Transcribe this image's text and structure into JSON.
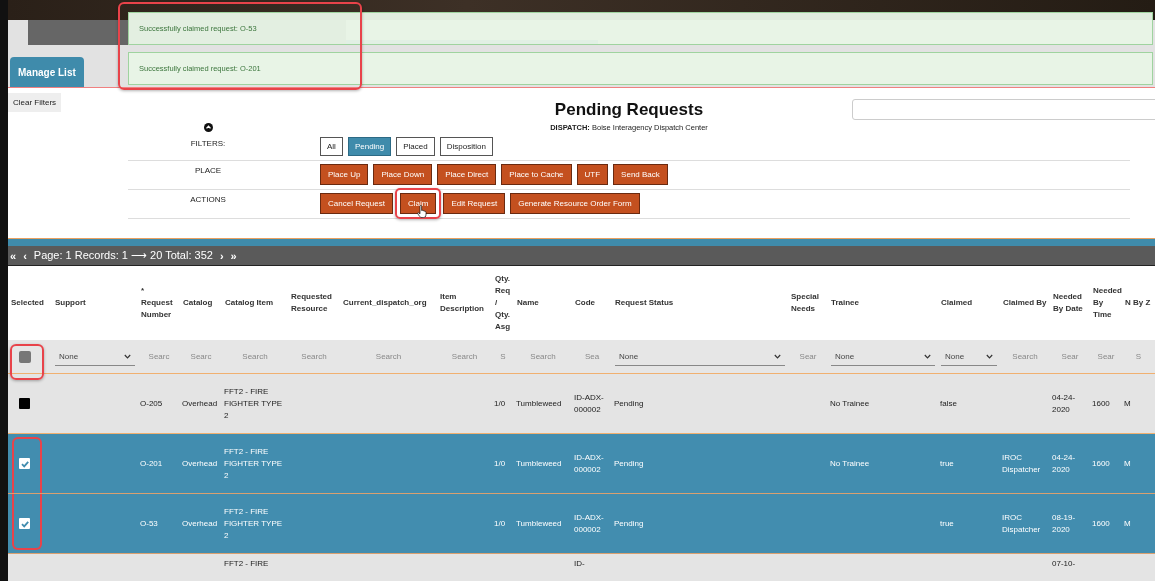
{
  "header": {
    "toasts": {
      "highlighted": true,
      "items": [
        "Successfully claimed request: O-53",
        "Successfully claimed request: O-201"
      ]
    },
    "manage_list": "Manage List",
    "clear_filters": "Clear Filters",
    "title": "Pending Requests",
    "dispatch": "**DISPATCH:** Boise Interagency Dispatch Center"
  },
  "button_groups": [
    {
      "label": "FILTERS:",
      "kind": "filter",
      "buttons": [
        {
          "label": "All",
          "selected": false,
          "highlighted": false
        },
        {
          "label": "Pending",
          "selected": true,
          "highlighted": false
        },
        {
          "label": "Placed",
          "selected": false,
          "highlighted": false
        },
        {
          "label": "Disposition",
          "selected": false,
          "highlighted": false
        }
      ]
    },
    {
      "label": "PLACE",
      "kind": "action",
      "buttons": [
        {
          "label": "Place Up",
          "highlighted": false
        },
        {
          "label": "Place Down",
          "highlighted": false
        },
        {
          "label": "Place Direct",
          "highlighted": false
        },
        {
          "label": "Place to Cache",
          "highlighted": false
        },
        {
          "label": "UTF",
          "highlighted": false
        },
        {
          "label": "Send Back",
          "highlighted": false
        }
      ]
    },
    {
      "label": "ACTIONS",
      "kind": "action",
      "buttons": [
        {
          "label": "Cancel Request",
          "highlighted": false
        },
        {
          "label": "Claim",
          "highlighted": true,
          "cursor": true
        },
        {
          "label": "Edit Request",
          "highlighted": false
        },
        {
          "label": "Generate Resource Order Form",
          "highlighted": false
        }
      ]
    }
  ],
  "pager": {
    "first": "«",
    "prev": "‹",
    "text": "Page: 1 Records: 1 ⟶ 20 Total: 352",
    "next": "›",
    "last": "»"
  },
  "table": {
    "columns": [
      "Selected",
      "Support",
      "*\nRequest Number",
      "Catalog",
      "Catalog Item",
      "Requested Resource",
      "Current_dispatch_org",
      "Item Description",
      "Qty. Req / Qty. Asg",
      "Name",
      "Code",
      "Request Status",
      "Special Needs",
      "Trainee",
      "Claimed",
      "Claimed By",
      "Needed By Date",
      "Needed By Time",
      "N By Z"
    ],
    "filters": [
      {
        "kind": "checkbox",
        "highlighted": true,
        "checked": false
      },
      {
        "kind": "select",
        "value": "None"
      },
      {
        "kind": "text",
        "placeholder": "Searc"
      },
      {
        "kind": "text",
        "placeholder": "Searc"
      },
      {
        "kind": "text",
        "placeholder": "Search"
      },
      {
        "kind": "text",
        "placeholder": "Search"
      },
      {
        "kind": "text",
        "placeholder": "Search"
      },
      {
        "kind": "text",
        "placeholder": "Search"
      },
      {
        "kind": "text",
        "placeholder": "S"
      },
      {
        "kind": "text",
        "placeholder": "Search"
      },
      {
        "kind": "text",
        "placeholder": "Sea"
      },
      {
        "kind": "select",
        "value": "None"
      },
      {
        "kind": "text",
        "placeholder": "Sear"
      },
      {
        "kind": "select",
        "value": "None"
      },
      {
        "kind": "select",
        "value": "None"
      },
      {
        "kind": "text",
        "placeholder": "Search"
      },
      {
        "kind": "text",
        "placeholder": "Sear"
      },
      {
        "kind": "text",
        "placeholder": "Sear"
      },
      {
        "kind": "text",
        "placeholder": "S"
      }
    ],
    "rows": [
      {
        "selected": false,
        "checked": false,
        "highlighted": false,
        "cut": false,
        "cells": [
          null,
          null,
          "O-205",
          "Overhead",
          "FFT2 - FIRE FIGHTER TYPE 2",
          null,
          null,
          null,
          "1/0",
          "Tumbleweed",
          "ID-ADX-000002",
          "Pending",
          null,
          "No Trainee",
          "false",
          null,
          "04-24-2020",
          "1600",
          "M"
        ]
      },
      {
        "selected": true,
        "checked": true,
        "highlighted": true,
        "cut": false,
        "cells": [
          null,
          null,
          "O-201",
          "Overhead",
          "FFT2 - FIRE FIGHTER TYPE 2",
          null,
          null,
          null,
          "1/0",
          "Tumbleweed",
          "ID-ADX-000002",
          "Pending",
          null,
          "No Trainee",
          "true",
          "IROC Dispatcher",
          "04-24-2020",
          "1600",
          "M"
        ]
      },
      {
        "selected": true,
        "checked": true,
        "highlighted": true,
        "cut": false,
        "cells": [
          null,
          null,
          "O-53",
          "Overhead",
          "FFT2 - FIRE FIGHTER TYPE 2",
          null,
          null,
          null,
          "1/0",
          "Tumbleweed",
          "ID-ADX-000002",
          "Pending",
          null,
          null,
          "true",
          "IROC Dispatcher",
          "08-19-2020",
          "1600",
          "M"
        ]
      },
      {
        "selected": false,
        "highlighted": false,
        "cut": true,
        "cells": [
          null,
          null,
          null,
          null,
          "FFT2 - FIRE",
          null,
          null,
          null,
          null,
          null,
          "ID-",
          null,
          null,
          null,
          null,
          null,
          "07-10-",
          null,
          null
        ]
      }
    ]
  }
}
